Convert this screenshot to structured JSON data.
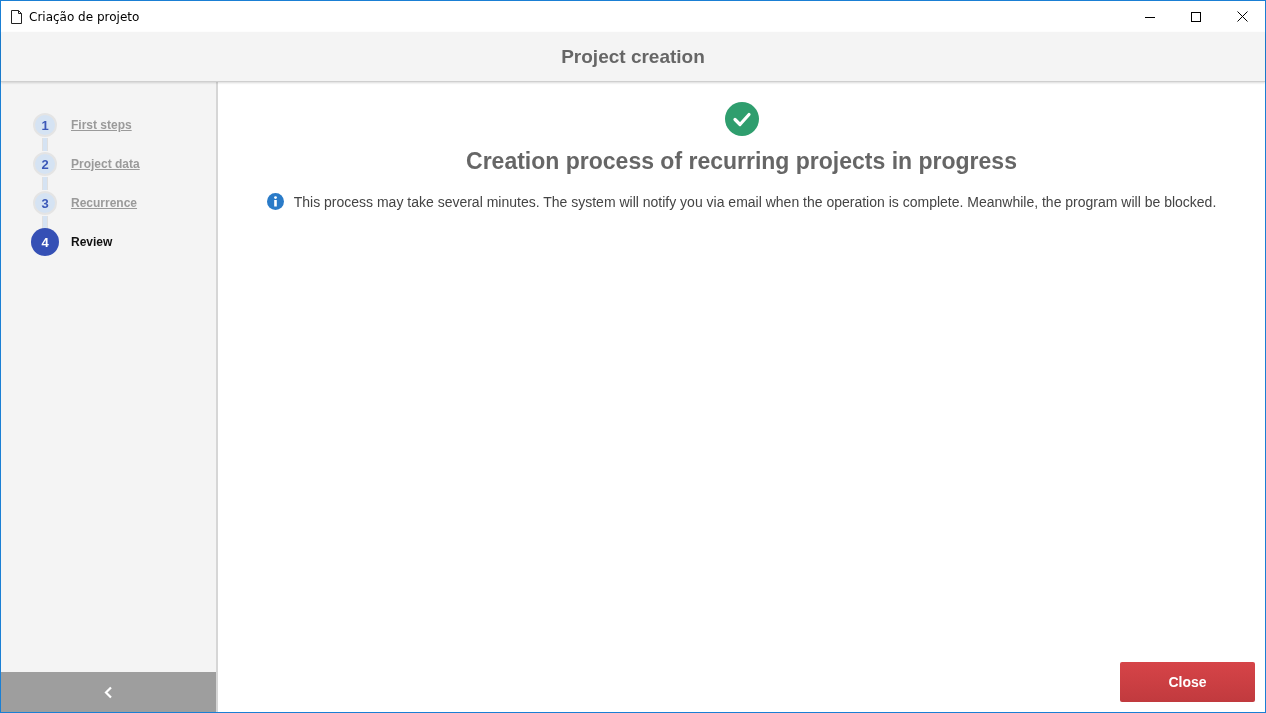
{
  "window": {
    "title": "Criação de projeto"
  },
  "header": {
    "title": "Project creation"
  },
  "steps": [
    {
      "number": "1",
      "label": "First steps",
      "selected": false
    },
    {
      "number": "2",
      "label": "Project data",
      "selected": false
    },
    {
      "number": "3",
      "label": "Recurrence",
      "selected": false
    },
    {
      "number": "4",
      "label": "Review",
      "selected": true
    }
  ],
  "main": {
    "heading": "Creation process of recurring projects in progress",
    "info": "This process may take several minutes. The system will notify you via email when the operation is complete. Meanwhile, the program will be blocked."
  },
  "buttons": [
    {
      "label": "Close"
    }
  ]
}
